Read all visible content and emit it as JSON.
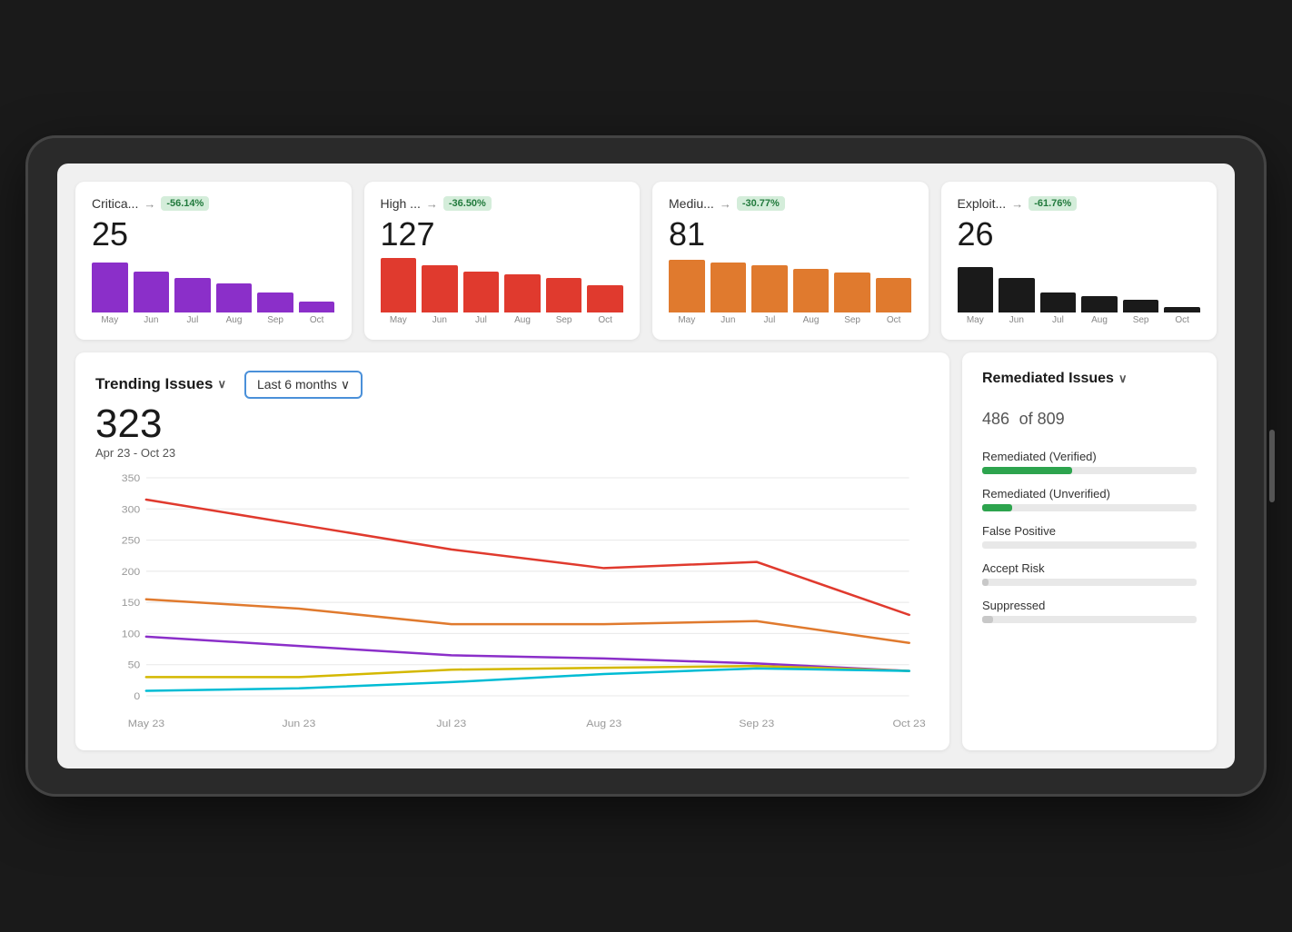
{
  "cards": [
    {
      "id": "critical",
      "title": "Critica...",
      "arrow": "→",
      "badge": "-56.14%",
      "number": "25",
      "color": "#8B2FC9",
      "months": [
        "May",
        "Jun",
        "Jul",
        "Aug",
        "Sep",
        "Oct"
      ],
      "heights": [
        55,
        45,
        38,
        32,
        22,
        12
      ]
    },
    {
      "id": "high",
      "title": "High ...",
      "arrow": "→",
      "badge": "-36.50%",
      "number": "127",
      "color": "#e03a2e",
      "months": [
        "May",
        "Jun",
        "Jul",
        "Aug",
        "Sep",
        "Oct"
      ],
      "heights": [
        60,
        52,
        45,
        42,
        38,
        30
      ]
    },
    {
      "id": "medium",
      "title": "Mediu...",
      "arrow": "→",
      "badge": "-30.77%",
      "number": "81",
      "color": "#e07a2e",
      "months": [
        "May",
        "Jun",
        "Jul",
        "Aug",
        "Sep",
        "Oct"
      ],
      "heights": [
        58,
        55,
        52,
        48,
        44,
        38
      ]
    },
    {
      "id": "exploit",
      "title": "Exploit...",
      "arrow": "→",
      "badge": "-61.76%",
      "number": "26",
      "color": "#1a1a1a",
      "months": [
        "May",
        "Jun",
        "Jul",
        "Aug",
        "Sep",
        "Oct"
      ],
      "heights": [
        50,
        38,
        22,
        18,
        14,
        6
      ]
    }
  ],
  "trending": {
    "title": "Trending Issues",
    "chevron": "∨",
    "filter": "Last 6 months",
    "filter_chevron": "∨",
    "number": "323",
    "date_range": "Apr 23 - Oct 23",
    "x_labels": [
      "May 23",
      "Jun 23",
      "Jul 23",
      "Aug 23",
      "Sep 23",
      "Oct 23"
    ],
    "y_labels": [
      "350",
      "300",
      "250",
      "200",
      "150",
      "100",
      "50",
      "0"
    ],
    "lines": [
      {
        "color": "#e03a2e",
        "points": [
          315,
          275,
          235,
          205,
          215,
          130
        ]
      },
      {
        "color": "#e07a2e",
        "points": [
          155,
          140,
          115,
          115,
          120,
          85
        ]
      },
      {
        "color": "#8B2FC9",
        "points": [
          95,
          80,
          65,
          60,
          52,
          40
        ]
      },
      {
        "color": "#d4b800",
        "points": [
          30,
          30,
          42,
          45,
          48,
          40
        ]
      },
      {
        "color": "#00bcd4",
        "points": [
          8,
          12,
          22,
          35,
          44,
          40
        ]
      }
    ]
  },
  "remediated": {
    "title": "Remediated Issues",
    "chevron": "∨",
    "count": "486",
    "total": "of 809",
    "items": [
      {
        "label": "Remediated (Verified)",
        "color": "#2da44e",
        "pct": 42
      },
      {
        "label": "Remediated (Unverified)",
        "color": "#2da44e",
        "pct": 14
      },
      {
        "label": "False Positive",
        "color": "#c8c8c8",
        "pct": 0
      },
      {
        "label": "Accept Risk",
        "color": "#c8c8c8",
        "pct": 3
      },
      {
        "label": "Suppressed",
        "color": "#c8c8c8",
        "pct": 5
      }
    ]
  }
}
